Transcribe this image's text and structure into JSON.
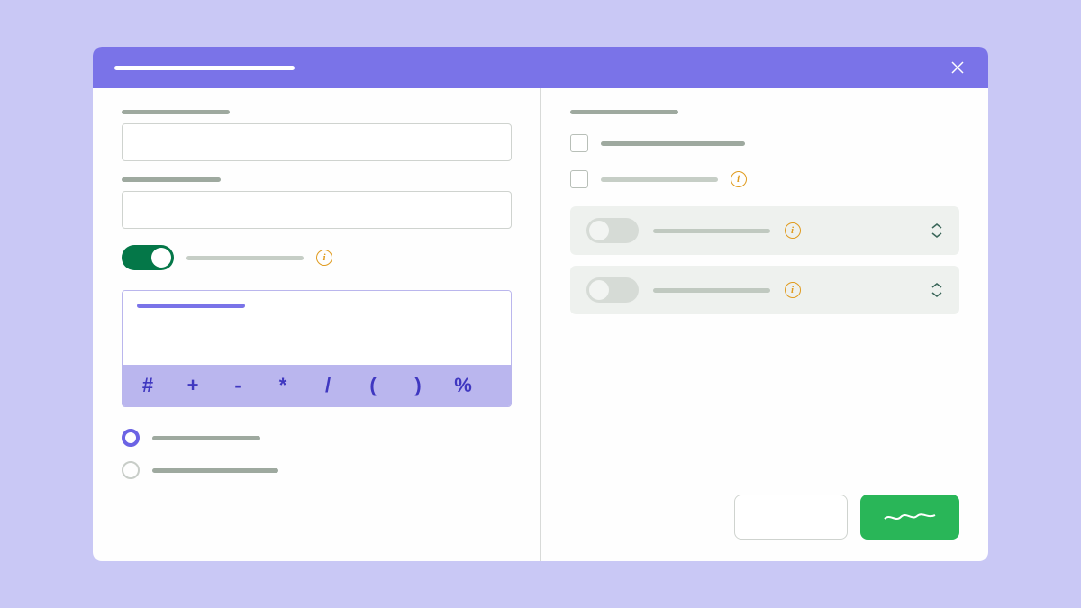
{
  "modal": {
    "title": "",
    "close_label": "Close"
  },
  "left": {
    "field1_label": "",
    "field1_value": "",
    "field2_label": "",
    "field2_value": "",
    "toggle1_on": true,
    "toggle1_label": "",
    "formula_label": "",
    "formula_value": "",
    "operators": [
      "#",
      "+",
      "-",
      "*",
      "/",
      "(",
      ")",
      "%"
    ],
    "radio_options": [
      {
        "label": "",
        "selected": true
      },
      {
        "label": "",
        "selected": false
      }
    ]
  },
  "right": {
    "section_label": "",
    "checkbox1_label": "",
    "checkbox1_checked": false,
    "checkbox2_label": "",
    "checkbox2_checked": false,
    "toggle_card1": {
      "on": false,
      "label": ""
    },
    "toggle_card2": {
      "on": false,
      "label": ""
    }
  },
  "actions": {
    "cancel_label": "",
    "submit_label": ""
  },
  "colors": {
    "accent": "#7a73e8",
    "success": "#29b658",
    "toggle_on": "#047748",
    "info": "#e09b1f"
  }
}
